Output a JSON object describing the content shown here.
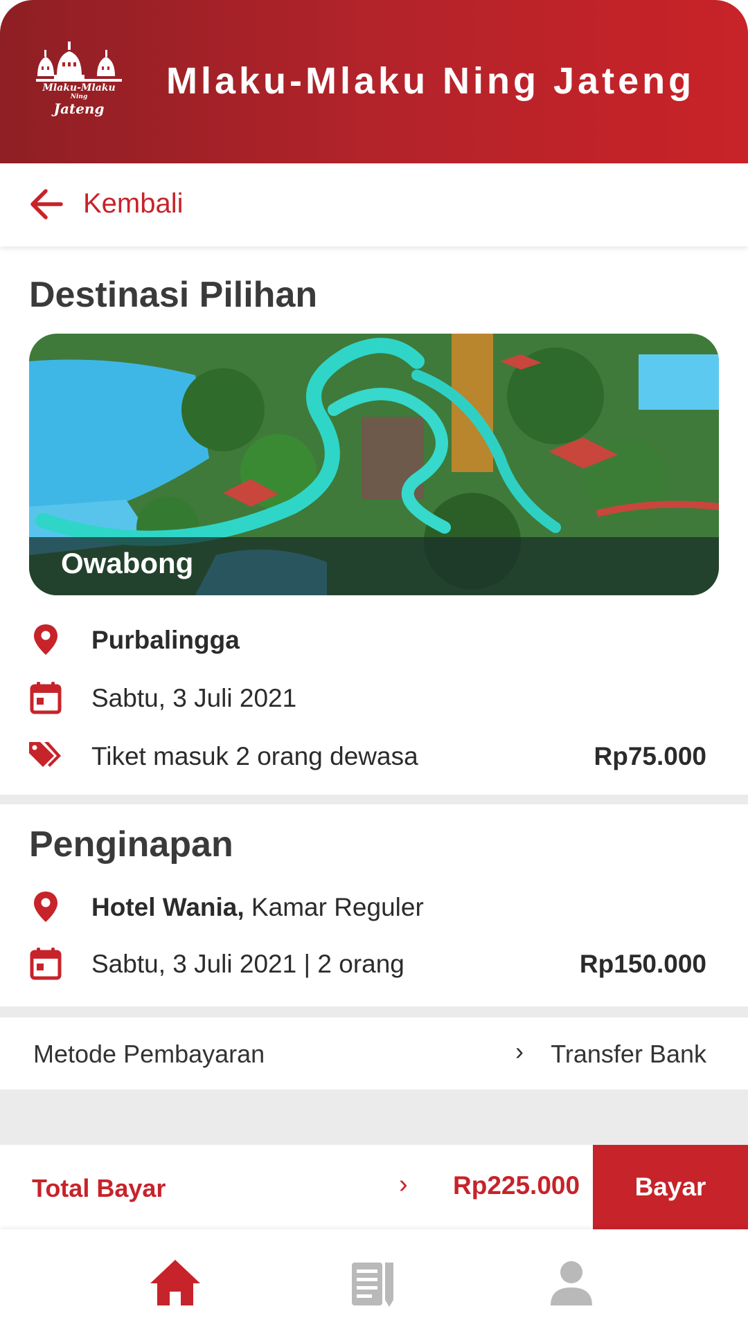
{
  "app": {
    "title": "Mlaku-Mlaku Ning Jateng",
    "logo_line1": "Mlaku-Mlaku",
    "logo_line2": "Ning",
    "logo_line3": "Jateng"
  },
  "nav": {
    "back_label": "Kembali"
  },
  "destination": {
    "section_title": "Destinasi Pilihan",
    "name": "Owabong",
    "location": "Purbalingga",
    "date": "Sabtu, 3 Juli 2021",
    "ticket_desc": "Tiket masuk 2 orang dewasa",
    "ticket_price": "Rp75.000"
  },
  "lodging": {
    "section_title": "Penginapan",
    "hotel_name": "Hotel Wania,",
    "room_type": " Kamar Reguler",
    "date_guests": "Sabtu, 3 Juli 2021 | 2 orang",
    "price": "Rp150.000"
  },
  "payment": {
    "label": "Metode Pembayaran",
    "chevron": "›",
    "method": "Transfer Bank"
  },
  "total": {
    "label": "Total Bayar",
    "chevron": "›",
    "amount": "Rp225.000",
    "pay_button": "Bayar"
  },
  "bottom_nav": {
    "items": [
      "home-icon",
      "news-icon",
      "profile-icon"
    ],
    "active": "home-icon"
  },
  "colors": {
    "brand_red": "#c7232a",
    "header_dark": "#8e1f24",
    "inactive_icon": "#b9b9b9",
    "divider": "#ebebeb"
  },
  "icons": {
    "back": "arrow-left-icon",
    "location": "map-pin-icon",
    "calendar": "calendar-icon",
    "ticket": "price-tags-icon"
  }
}
